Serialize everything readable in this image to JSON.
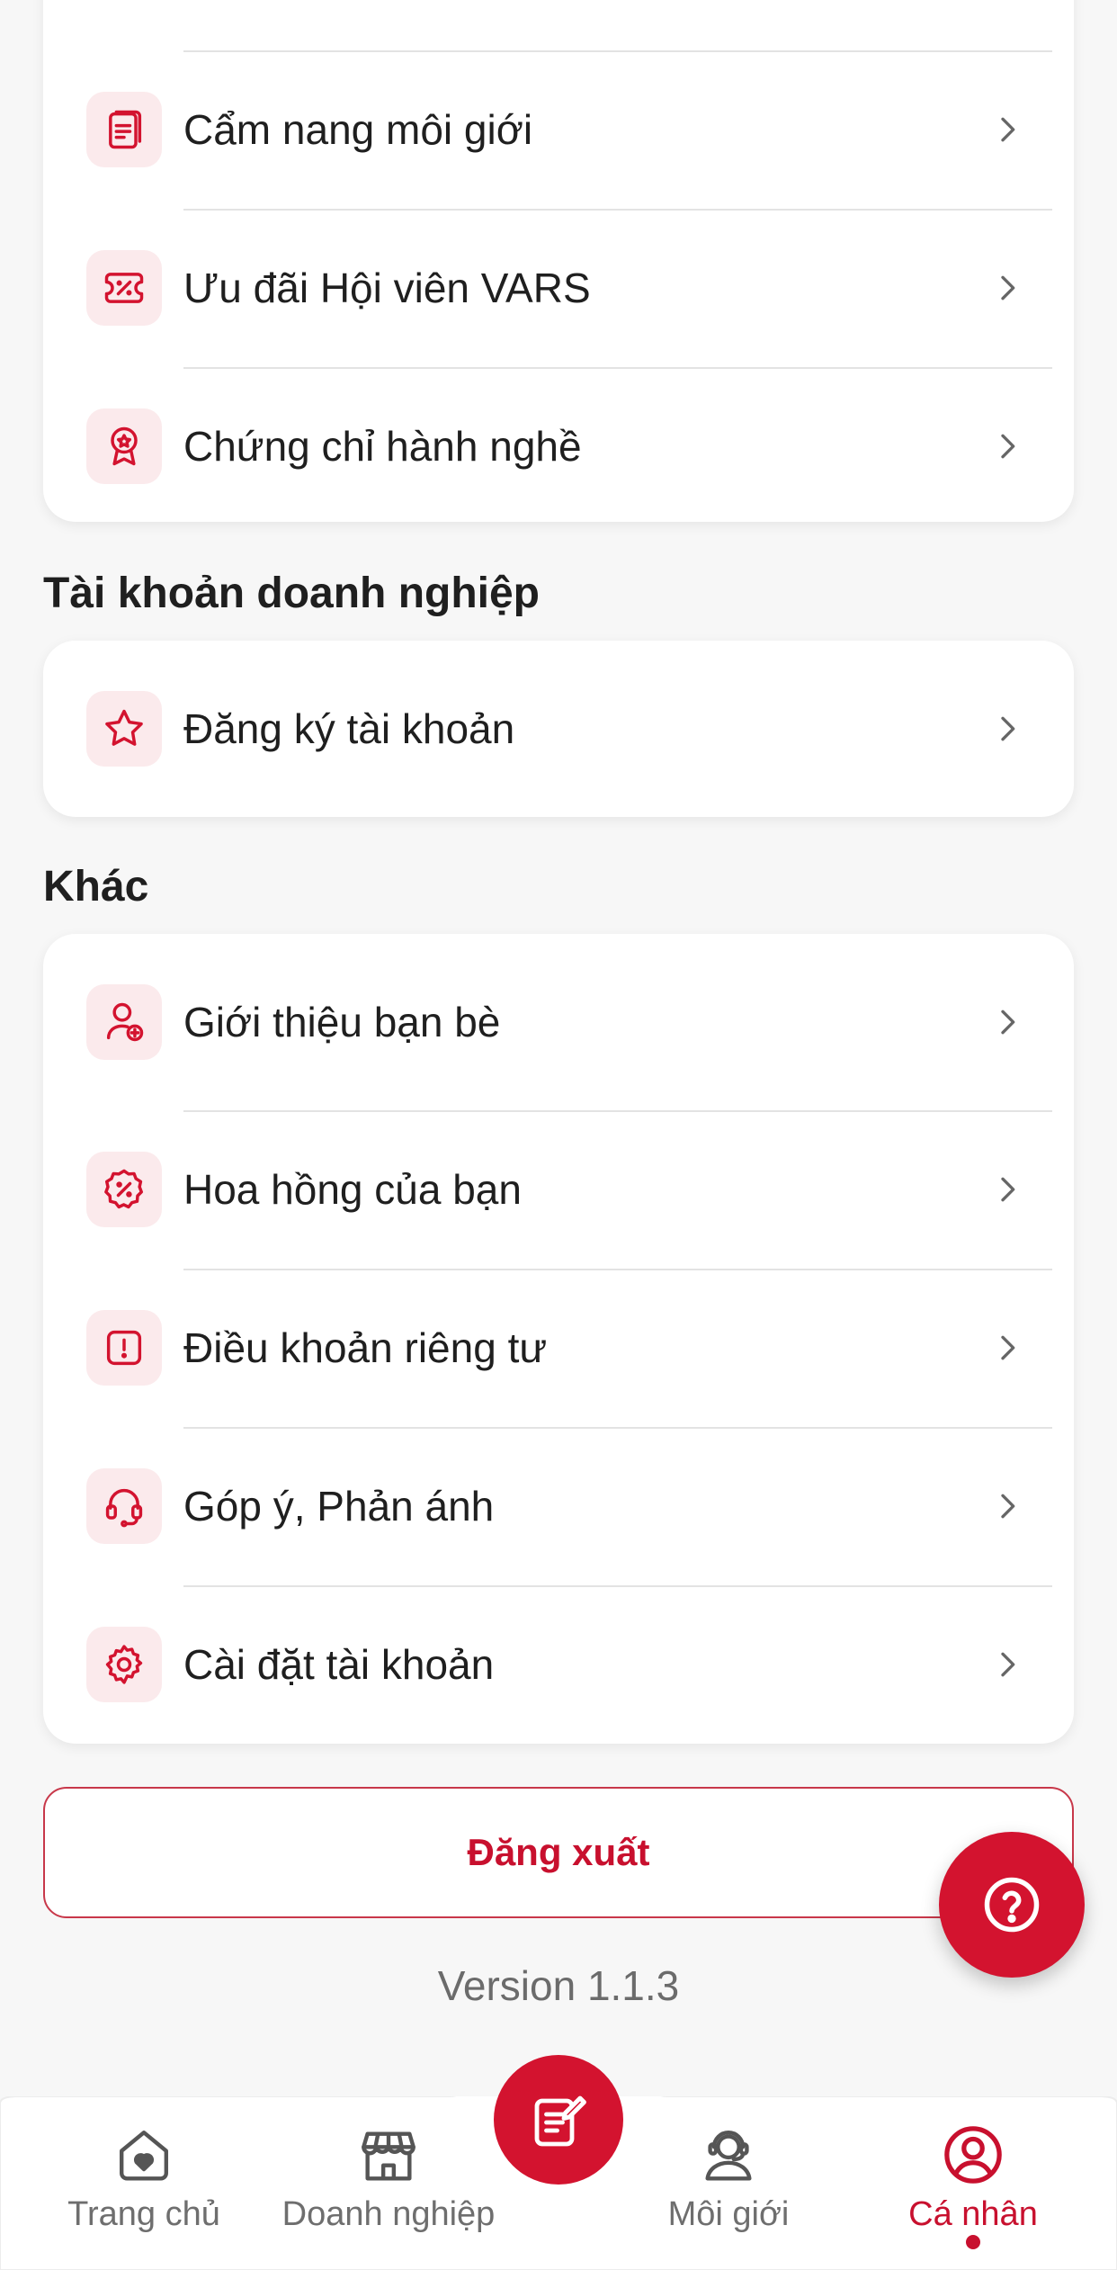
{
  "card_top": {
    "items": [
      {
        "label": "Cẩm nang môi giới",
        "icon": "handbook-icon"
      },
      {
        "label": "Ưu đãi Hội viên VARS",
        "icon": "voucher-icon"
      },
      {
        "label": "Chứng chỉ hành nghề",
        "icon": "certificate-icon"
      }
    ]
  },
  "section_business": {
    "title": "Tài khoản doanh nghiệp",
    "items": [
      {
        "label": "Đăng ký tài khoản",
        "icon": "star-icon"
      }
    ]
  },
  "section_other": {
    "title": "Khác",
    "items": [
      {
        "label": "Giới thiệu bạn bè",
        "icon": "add-user-icon"
      },
      {
        "label": "Hoa hồng của bạn",
        "icon": "commission-icon"
      },
      {
        "label": "Điều khoản riêng tư",
        "icon": "alert-icon"
      },
      {
        "label": "Góp ý, Phản ánh",
        "icon": "headset-icon"
      },
      {
        "label": "Cài đặt tài khoản",
        "icon": "gear-icon"
      }
    ]
  },
  "logout_label": "Đăng xuất",
  "version_text": "Version 1.1.3",
  "bottom_nav": {
    "items": [
      {
        "label": "Trang chủ",
        "icon": "home-heart-icon"
      },
      {
        "label": "Doanh nghiệp",
        "icon": "store-icon"
      },
      {
        "label": "Môi giới",
        "icon": "broker-icon"
      },
      {
        "label": "Cá nhân",
        "icon": "profile-icon",
        "active": true
      }
    ]
  },
  "colors": {
    "accent": "#d3132f",
    "icon_bg": "#fbeaec",
    "background": "#f7f7f7"
  }
}
